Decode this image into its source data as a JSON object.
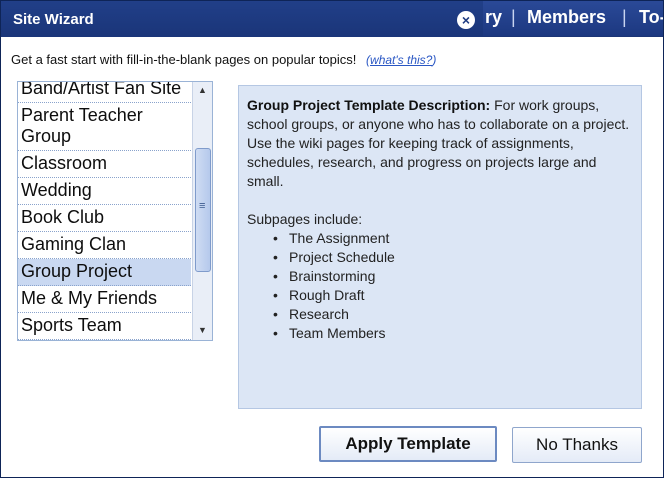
{
  "app_nav": {
    "items": [
      "ry",
      "Members",
      "To-"
    ]
  },
  "dialog": {
    "title": "Site Wizard",
    "close_icon": "×"
  },
  "intro": {
    "text": "Get a fast start with fill-in-the-blank pages on popular topics!",
    "link_open": "(",
    "link_label": "what's this?",
    "link_close": ")"
  },
  "templates": {
    "items": [
      {
        "label": "Band/Artist Fan Site"
      },
      {
        "label": "Parent Teacher Group"
      },
      {
        "label": "Classroom"
      },
      {
        "label": "Wedding"
      },
      {
        "label": "Book Club"
      },
      {
        "label": "Gaming Clan"
      },
      {
        "label": "Group Project",
        "selected": true
      },
      {
        "label": "Me & My Friends"
      },
      {
        "label": "Sports Team"
      }
    ],
    "scroll_up_icon": "▲",
    "scroll_down_icon": "▼",
    "grip_icon": "≡"
  },
  "description": {
    "title": "Group Project Template Description:",
    "body": "For work groups, school groups, or anyone who has to collaborate on a project. Use the wiki pages for keeping track of assignments, schedules, research, and progress on projects large and small.",
    "subpages_heading": "Subpages include:",
    "subpages": [
      "The Assignment",
      "Project Schedule",
      "Brainstorming",
      "Rough Draft",
      "Research",
      "Team Members"
    ]
  },
  "buttons": {
    "apply": "Apply Template",
    "no_thanks": "No Thanks"
  }
}
